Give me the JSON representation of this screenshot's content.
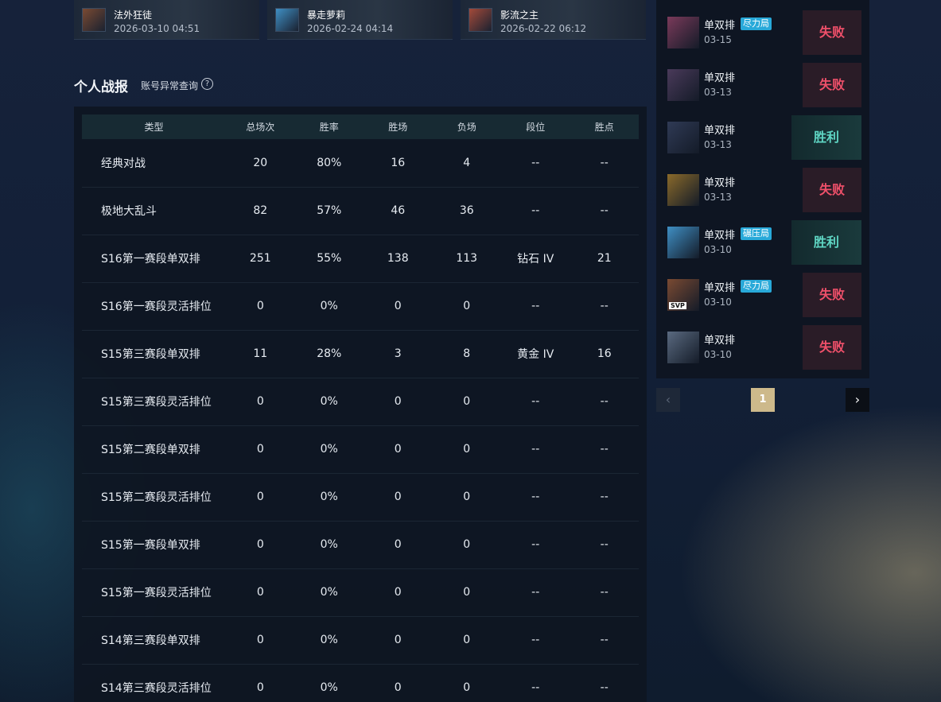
{
  "recent_heroes": [
    {
      "name": "法外狂徒",
      "time": "2026-03-10 04:51",
      "color": "#7a4a32"
    },
    {
      "name": "暴走萝莉",
      "time": "2026-02-24 04:14",
      "color": "#3f8fc4"
    },
    {
      "name": "影流之主",
      "time": "2026-02-22 06:12",
      "color": "#a34a3a"
    }
  ],
  "section": {
    "title": "个人战报",
    "anomaly_link": "账号异常查询",
    "help_glyph": "?"
  },
  "stats_table": {
    "headers": [
      "类型",
      "总场次",
      "胜率",
      "胜场",
      "负场",
      "段位",
      "胜点"
    ],
    "rows": [
      [
        "经典对战",
        "20",
        "80%",
        "16",
        "4",
        "--",
        "--"
      ],
      [
        "极地大乱斗",
        "82",
        "57%",
        "46",
        "36",
        "--",
        "--"
      ],
      [
        "S16第一赛段单双排",
        "251",
        "55%",
        "138",
        "113",
        "钻石 IV",
        "21"
      ],
      [
        "S16第一赛段灵活排位",
        "0",
        "0%",
        "0",
        "0",
        "--",
        "--"
      ],
      [
        "S15第三赛段单双排",
        "11",
        "28%",
        "3",
        "8",
        "黄金 IV",
        "16"
      ],
      [
        "S15第三赛段灵活排位",
        "0",
        "0%",
        "0",
        "0",
        "--",
        "--"
      ],
      [
        "S15第二赛段单双排",
        "0",
        "0%",
        "0",
        "0",
        "--",
        "--"
      ],
      [
        "S15第二赛段灵活排位",
        "0",
        "0%",
        "0",
        "0",
        "--",
        "--"
      ],
      [
        "S15第一赛段单双排",
        "0",
        "0%",
        "0",
        "0",
        "--",
        "--"
      ],
      [
        "S15第一赛段灵活排位",
        "0",
        "0%",
        "0",
        "0",
        "--",
        "--"
      ],
      [
        "S14第三赛段单双排",
        "0",
        "0%",
        "0",
        "0",
        "--",
        "--"
      ],
      [
        "S14第三赛段灵活排位",
        "0",
        "0%",
        "0",
        "0",
        "--",
        "--"
      ]
    ]
  },
  "matches": [
    {
      "mode": "单双排",
      "tag": "尽力局",
      "date": "03-15",
      "result": "失败",
      "outcome": "lose",
      "avatar_color": "#7a3a5a"
    },
    {
      "mode": "单双排",
      "tag": "",
      "date": "03-13",
      "result": "失败",
      "outcome": "lose",
      "avatar_color": "#4a3a5a"
    },
    {
      "mode": "单双排",
      "tag": "",
      "date": "03-13",
      "result": "胜利",
      "outcome": "win",
      "avatar_color": "#2f3a55"
    },
    {
      "mode": "单双排",
      "tag": "",
      "date": "03-13",
      "result": "失败",
      "outcome": "lose",
      "avatar_color": "#8a6a2a"
    },
    {
      "mode": "单双排",
      "tag": "碾压局",
      "date": "03-10",
      "result": "胜利",
      "outcome": "win",
      "avatar_color": "#3f8fc4"
    },
    {
      "mode": "单双排",
      "tag": "尽力局",
      "date": "03-10",
      "result": "失败",
      "outcome": "lose",
      "avatar_color": "#7a4a32",
      "badge": "SVP"
    },
    {
      "mode": "单双排",
      "tag": "",
      "date": "03-10",
      "result": "失败",
      "outcome": "lose",
      "avatar_color": "#5a6a80"
    }
  ],
  "pagination": {
    "prev": "‹",
    "current": "1",
    "next": "›"
  },
  "colors": {
    "win": "#5fd6c4",
    "lose": "#f0506a",
    "tag": "#28a9d9",
    "page_active": "#cdb98b"
  }
}
